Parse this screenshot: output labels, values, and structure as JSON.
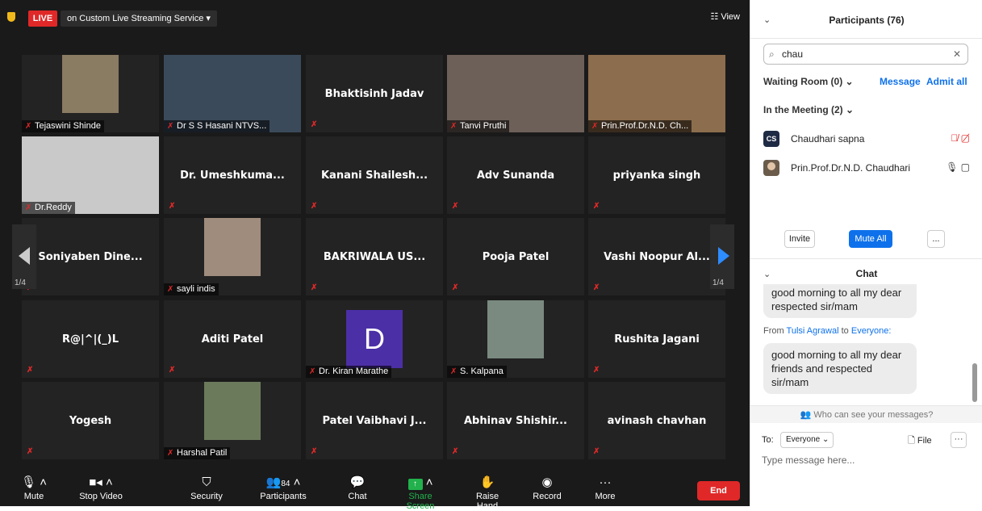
{
  "top": {
    "live": "LIVE",
    "service": "on Custom Live Streaming Service  ▾",
    "view": "☷ View"
  },
  "tiles": [
    {
      "label": "Tejaswini Shinde",
      "name": "",
      "photo": true
    },
    {
      "label": "Dr S S Hasani NTVS...",
      "name": "",
      "photo": true
    },
    {
      "label": "",
      "name": "Bhaktisinh Jadav",
      "photo": false
    },
    {
      "label": "Tanvi Pruthi",
      "name": "",
      "photo": true
    },
    {
      "label": "Prin.Prof.Dr.N.D. Ch...",
      "name": "",
      "photo": true,
      "speaker": true
    },
    {
      "label": "Dr.Reddy",
      "name": "",
      "photo": true
    },
    {
      "label": "",
      "name": "Dr. Umeshkuma...",
      "photo": false
    },
    {
      "label": "",
      "name": "Kanani  Shailesh...",
      "photo": false
    },
    {
      "label": "",
      "name": "Adv Sunanda",
      "photo": false
    },
    {
      "label": "",
      "name": "priyanka singh",
      "photo": false
    },
    {
      "label": "",
      "name": "Soniyaben  Dine...",
      "photo": false
    },
    {
      "label": "sayli indis",
      "name": "",
      "photo": true
    },
    {
      "label": "",
      "name": "BAKRIWALA US...",
      "photo": false
    },
    {
      "label": "",
      "name": "Pooja Patel",
      "photo": false
    },
    {
      "label": "",
      "name": "Vashi Noopur Al...",
      "photo": false
    },
    {
      "label": "",
      "name": "R@|^|(_)L",
      "photo": false
    },
    {
      "label": "",
      "name": "Aditi Patel",
      "photo": false
    },
    {
      "label": "Dr. Kiran Marathe",
      "name": "",
      "photo": true,
      "letter": "D"
    },
    {
      "label": "S. Kalpana",
      "name": "",
      "photo": true
    },
    {
      "label": "",
      "name": "Rushita Jagani",
      "photo": false
    },
    {
      "label": "",
      "name": "Yogesh",
      "photo": false
    },
    {
      "label": "Harshal Patil",
      "name": "",
      "photo": true
    },
    {
      "label": "",
      "name": "Patel Vaibhavi J...",
      "photo": false
    },
    {
      "label": "",
      "name": "Abhinav  Shishir...",
      "photo": false
    },
    {
      "label": "",
      "name": "avinash chavhan",
      "photo": false
    }
  ],
  "pages": {
    "left": "1/4",
    "right": "1/4"
  },
  "toolbar": {
    "mute": "Mute",
    "video": "Stop Video",
    "security": "Security",
    "participants": "Participants",
    "count": "84",
    "chat": "Chat",
    "share": "Share Screen",
    "raise": "Raise Hand",
    "record": "Record",
    "more": "More",
    "end": "End"
  },
  "participants": {
    "title": "Participants (76)",
    "search": "chau",
    "waiting": "Waiting Room (0)  ⌄",
    "message": "Message",
    "admit": "Admit all",
    "in_meeting": "In the Meeting (2)  ⌄",
    "list": [
      {
        "initials": "CS",
        "name": "Chaudhari sapna",
        "color": "#1f2a44"
      },
      {
        "initials": "",
        "name": "Prin.Prof.Dr.N.D. Chaudhari",
        "color": "#6b5b4b"
      }
    ],
    "invite": "Invite",
    "mute_all": "Mute All",
    "more": "..."
  },
  "chat": {
    "title": "Chat",
    "msg1": "good morning to all my dear respected sir/mam",
    "from_prefix": "From",
    "sender": "Tulsi Agrawal",
    "to_word": "to",
    "to_target": "Everyone:",
    "msg2": "good morning to all my dear friends and respected sir/mam",
    "who": "Who can see your messages?",
    "to_label": "To:",
    "everyone": "Everyone ⌄",
    "file": "File",
    "more": "···",
    "placeholder": "Type message here..."
  }
}
